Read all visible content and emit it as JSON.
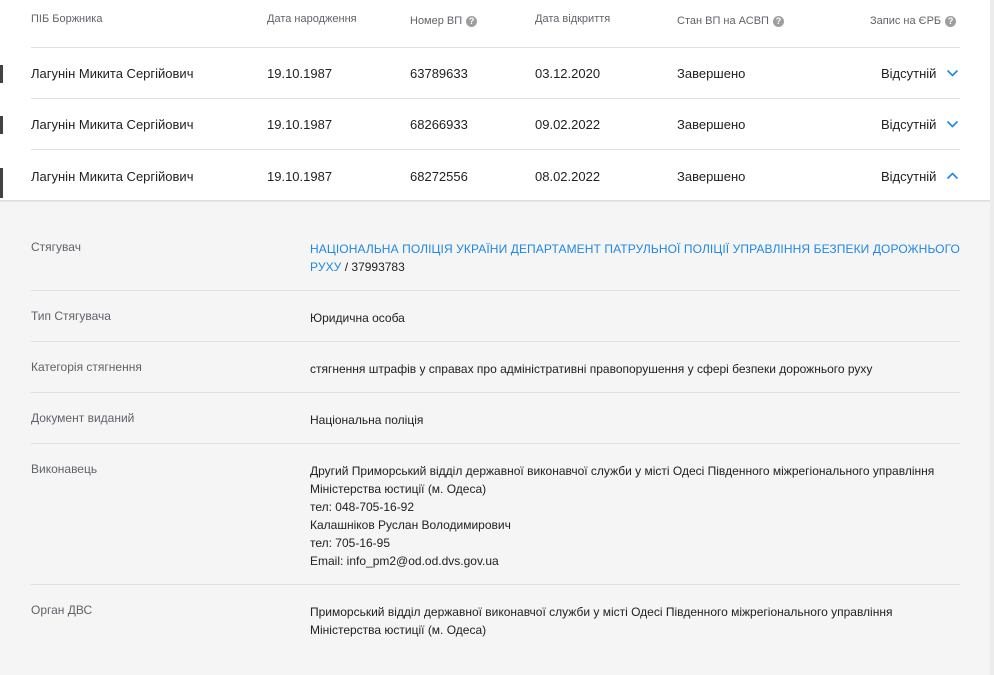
{
  "headers": {
    "name": "ПІБ Боржника",
    "birth": "Дата народження",
    "vp_number": "Номер ВП",
    "open_date": "Дата відкриття",
    "state": "Стан ВП на АСВП",
    "erb": "Запис на ЄРБ"
  },
  "rows": [
    {
      "name": "Лагунін Микита Сергійович",
      "birth": "19.10.1987",
      "vp": "63789633",
      "opened": "03.12.2020",
      "state": "Завершено",
      "erb": "Відсутній",
      "expanded": false
    },
    {
      "name": "Лагунін Микита Сергійович",
      "birth": "19.10.1987",
      "vp": "68266933",
      "opened": "09.02.2022",
      "state": "Завершено",
      "erb": "Відсутній",
      "expanded": false
    },
    {
      "name": "Лагунін Микита Сергійович",
      "birth": "19.10.1987",
      "vp": "68272556",
      "opened": "08.02.2022",
      "state": "Завершено",
      "erb": "Відсутній",
      "expanded": true
    }
  ],
  "details": {
    "creditor_label": "Стягувач",
    "creditor_link": "Національна поліція України Департамент патрульної поліції управління безпеки дорожнього руху",
    "creditor_code": " / 37993783",
    "creditor_type_label": "Тип Стягувача",
    "creditor_type": "Юридична особа",
    "category_label": "Категорія стягнення",
    "category": "стягнення штрафів у справах про адміністративні правопорушення у сфері безпеки дорожнього руху",
    "doc_label": "Документ виданий",
    "doc": "Національна поліція",
    "executor_label": "Виконавець",
    "executor_lines": [
      "Другий Приморський відділ державної виконавчої служби у місті Одесі Південного міжрегіонального управління",
      "Міністерства юстиції (м. Одеса)",
      "тел: 048-705-16-92",
      "Калашніков Руслан Володимирович",
      "тел: 705-16-95",
      "Email: info_pm2@od.od.dvs.gov.ua"
    ],
    "dvs_label": "Орган ДВС",
    "dvs_lines": [
      "Приморський відділ державної виконавчої служби у місті Одесі Південного міжрегіонального управління",
      "Міністерства юстиції (м. Одеса)"
    ]
  },
  "colors": {
    "link": "#1e88e5",
    "chevron": "#1e88e5",
    "detail_bg": "#f5f5f5"
  },
  "icons": {
    "help": "help-circle-icon",
    "collapsed": "chevron-down-icon",
    "expanded": "chevron-up-icon"
  }
}
